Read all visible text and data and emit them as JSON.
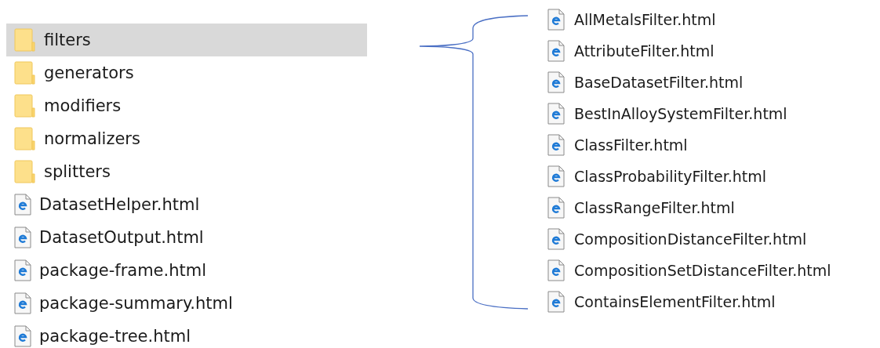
{
  "folder_list": {
    "items": [
      {
        "kind": "folder",
        "name": "filters",
        "selected": true
      },
      {
        "kind": "folder",
        "name": "generators",
        "selected": false
      },
      {
        "kind": "folder",
        "name": "modifiers",
        "selected": false
      },
      {
        "kind": "folder",
        "name": "normalizers",
        "selected": false
      },
      {
        "kind": "folder",
        "name": "splitters",
        "selected": false
      },
      {
        "kind": "file",
        "name": "DatasetHelper.html",
        "selected": false
      },
      {
        "kind": "file",
        "name": "DatasetOutput.html",
        "selected": false
      },
      {
        "kind": "file",
        "name": "package-frame.html",
        "selected": false
      },
      {
        "kind": "file",
        "name": "package-summary.html",
        "selected": false
      },
      {
        "kind": "file",
        "name": "package-tree.html",
        "selected": false
      }
    ]
  },
  "filters_contents": {
    "items": [
      {
        "kind": "file",
        "name": "AllMetalsFilter.html"
      },
      {
        "kind": "file",
        "name": "AttributeFilter.html"
      },
      {
        "kind": "file",
        "name": "BaseDatasetFilter.html"
      },
      {
        "kind": "file",
        "name": "BestInAlloySystemFilter.html"
      },
      {
        "kind": "file",
        "name": "ClassFilter.html"
      },
      {
        "kind": "file",
        "name": "ClassProbabilityFilter.html"
      },
      {
        "kind": "file",
        "name": "ClassRangeFilter.html"
      },
      {
        "kind": "file",
        "name": "CompositionDistanceFilter.html"
      },
      {
        "kind": "file",
        "name": "CompositionSetDistanceFilter.html"
      },
      {
        "kind": "file",
        "name": "ContainsElementFilter.html"
      }
    ]
  }
}
